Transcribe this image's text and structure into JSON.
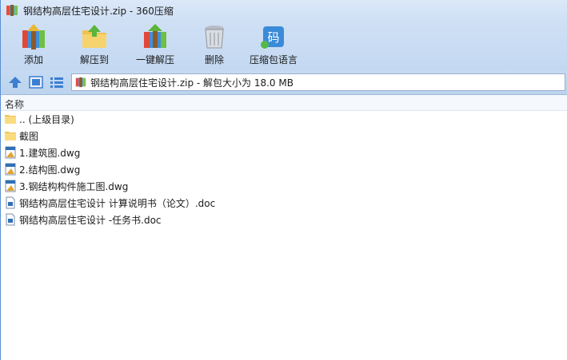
{
  "window": {
    "title": "钢结构高层住宅设计.zip - 360压缩"
  },
  "toolbar": {
    "add": "添加",
    "extract_to": "解压到",
    "quick_extract": "一键解压",
    "delete": "删除",
    "language": "压缩包语言"
  },
  "address": {
    "text": "钢结构高层住宅设计.zip - 解包大小为 18.0 MB"
  },
  "list": {
    "column_name": "名称",
    "items": [
      {
        "name": ".. (上级目录)",
        "icon": "folder-icon"
      },
      {
        "name": "截图",
        "icon": "folder-icon"
      },
      {
        "name": "1.建筑图.dwg",
        "icon": "dwg-file-icon"
      },
      {
        "name": "2.结构图.dwg",
        "icon": "dwg-file-icon"
      },
      {
        "name": "3.钢结构构件施工图.dwg",
        "icon": "dwg-file-icon"
      },
      {
        "name": "钢结构高层住宅设计 计算说明书（论文）.doc",
        "icon": "doc-file-icon"
      },
      {
        "name": "钢结构高层住宅设计 -任务书.doc",
        "icon": "doc-file-icon"
      }
    ]
  },
  "colors": {
    "accent": "#3c7fd1",
    "folder": "#f6d56b",
    "chrome": "#cfe0f5"
  },
  "icons": {
    "app": "archive-icon",
    "add": "add-archive-icon",
    "extract_to": "extract-folder-icon",
    "quick_extract": "quick-extract-icon",
    "delete": "trash-icon",
    "language": "language-code-icon",
    "language_glyph": "码",
    "up": "up-arrow-icon",
    "view": "large-icon-view-icon",
    "list": "list-view-icon"
  }
}
